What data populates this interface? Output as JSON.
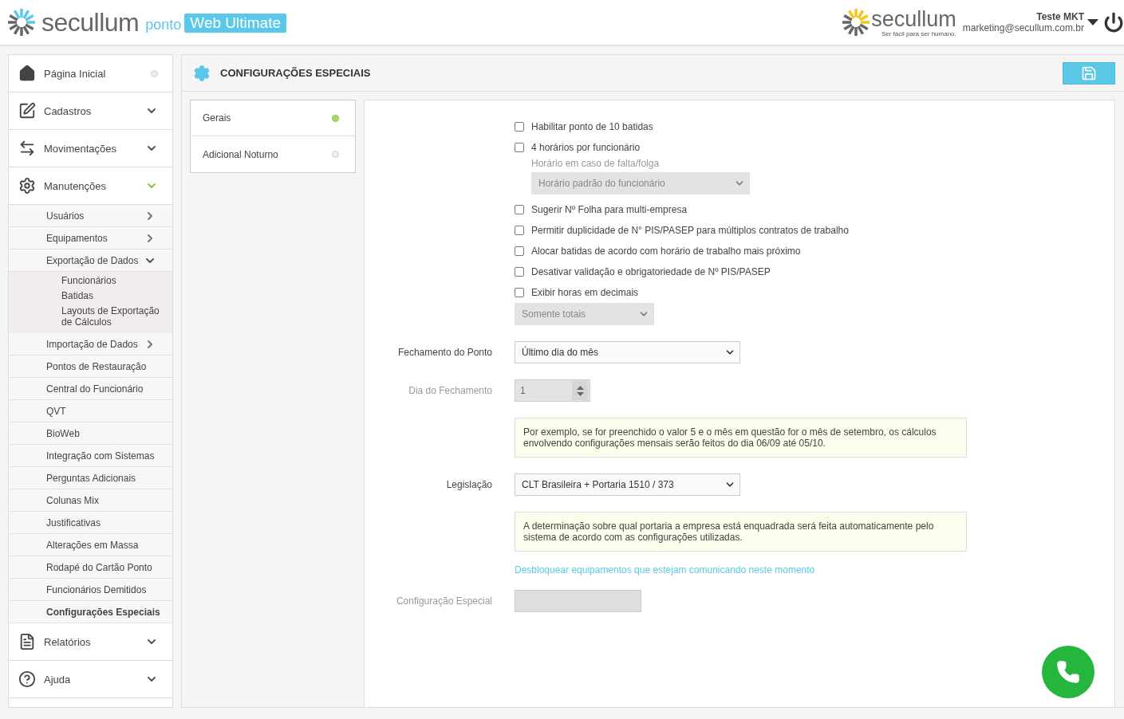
{
  "header": {
    "brand": "secullum",
    "product": "ponto",
    "edition": "Web Ultimate",
    "company_logo": "secullum",
    "company_slogan": "Ser fácil para ser humano.",
    "user_name": "Teste MKT",
    "user_email": "marketing@secullum.com.br"
  },
  "sidebar": {
    "items": [
      {
        "label": "Página Inicial",
        "kind": "link",
        "expanded": false
      },
      {
        "label": "Cadastros",
        "kind": "menu",
        "expanded": false
      },
      {
        "label": "Movimentações",
        "kind": "menu",
        "expanded": false
      },
      {
        "label": "Manutenções",
        "kind": "menu",
        "expanded": true,
        "children": [
          {
            "label": "Usuários",
            "kind": "submenu",
            "expanded": false,
            "selected": false
          },
          {
            "label": "Equipamentos",
            "kind": "submenu",
            "expanded": false,
            "selected": false
          },
          {
            "label": "Exportação de Dados",
            "kind": "submenu",
            "expanded": true,
            "selected": false,
            "children": [
              {
                "label": "Funcionários",
                "selected": false
              },
              {
                "label": "Batidas",
                "selected": false
              },
              {
                "label": "Layouts de Exportação de Cálculos",
                "selected": false
              }
            ]
          },
          {
            "label": "Importação de Dados",
            "kind": "submenu",
            "expanded": false,
            "selected": false
          },
          {
            "label": "Pontos de Restauração",
            "kind": "link",
            "selected": false
          },
          {
            "label": "Central do Funcionário",
            "kind": "link",
            "selected": false
          },
          {
            "label": "QVT",
            "kind": "link",
            "selected": false
          },
          {
            "label": "BioWeb",
            "kind": "link",
            "selected": false
          },
          {
            "label": "Integração com Sistemas",
            "kind": "link",
            "selected": false
          },
          {
            "label": "Perguntas Adicionais",
            "kind": "link",
            "selected": false
          },
          {
            "label": "Colunas Mix",
            "kind": "link",
            "selected": false
          },
          {
            "label": "Justificativas",
            "kind": "link",
            "selected": false
          },
          {
            "label": "Alterações em Massa",
            "kind": "link",
            "selected": false
          },
          {
            "label": "Rodapé do Cartão Ponto",
            "kind": "link",
            "selected": false
          },
          {
            "label": "Funcionários Demitidos",
            "kind": "link",
            "selected": false
          },
          {
            "label": "Configurações Especiais",
            "kind": "link",
            "selected": true
          }
        ]
      },
      {
        "label": "Relatórios",
        "kind": "menu",
        "expanded": false
      },
      {
        "label": "Ajuda",
        "kind": "menu",
        "expanded": false
      }
    ]
  },
  "panel": {
    "title": "CONFIGURAÇÕES ESPECIAIS"
  },
  "tabs": [
    {
      "label": "Gerais",
      "selected": true
    },
    {
      "label": "Adicional Noturno",
      "selected": false
    }
  ],
  "form": {
    "rows": [
      {
        "kind": "checkbox",
        "text": "Habilitar ponto de 10 batidas",
        "checked": false
      },
      {
        "kind": "checkbox",
        "text": "4 horários por funcionário",
        "checked": false
      },
      {
        "kind": "caption",
        "text": "Horário em caso de falta/folga"
      },
      {
        "kind": "subselect",
        "value": "Horário padrão do funcionário",
        "disabled": true
      },
      {
        "kind": "checkbox",
        "text": "Sugerir Nº Folha para multi-empresa",
        "checked": false
      },
      {
        "kind": "checkbox",
        "text": "Permitir duplicidade de N° PIS/PASEP para múltiplos contratos de trabalho",
        "checked": false
      },
      {
        "kind": "checkbox",
        "text": "Alocar batidas de acordo com horário de trabalho mais próximo",
        "checked": false
      },
      {
        "kind": "checkbox",
        "text": "Desativar validação e obrigatoriedade de Nº PIS/PASEP",
        "checked": false
      },
      {
        "kind": "checkbox",
        "text": "Exibir horas em decimais",
        "checked": false
      },
      {
        "kind": "smallselect",
        "value": "Somente totais",
        "disabled": true
      },
      {
        "kind": "select",
        "label": "Fechamento do Ponto",
        "value": "Último dia do mês",
        "disabled": false
      },
      {
        "kind": "number",
        "label": "Dia do Fechamento",
        "value": "1",
        "disabled": true
      },
      {
        "kind": "note",
        "text": "Por exemplo, se for preenchido o valor 5 e o mês em questão for o mês de setembro, os cálculos envolvendo configurações mensais serão feitos do dia 06/09 até 05/10."
      },
      {
        "kind": "select",
        "label": "Legislação",
        "value": "CLT Brasileira + Portaria 1510 / 373",
        "disabled": false
      },
      {
        "kind": "note",
        "text": "A determinação sobre qual portaria a empresa está enquadrada será feita automaticamente pelo sistema de acordo com as configurações utilizadas."
      },
      {
        "kind": "link",
        "text": "Desbloquear equipamentos que estejam comunicando neste momento"
      },
      {
        "kind": "text",
        "label": "Configuração Especial",
        "disabled": true
      }
    ]
  }
}
